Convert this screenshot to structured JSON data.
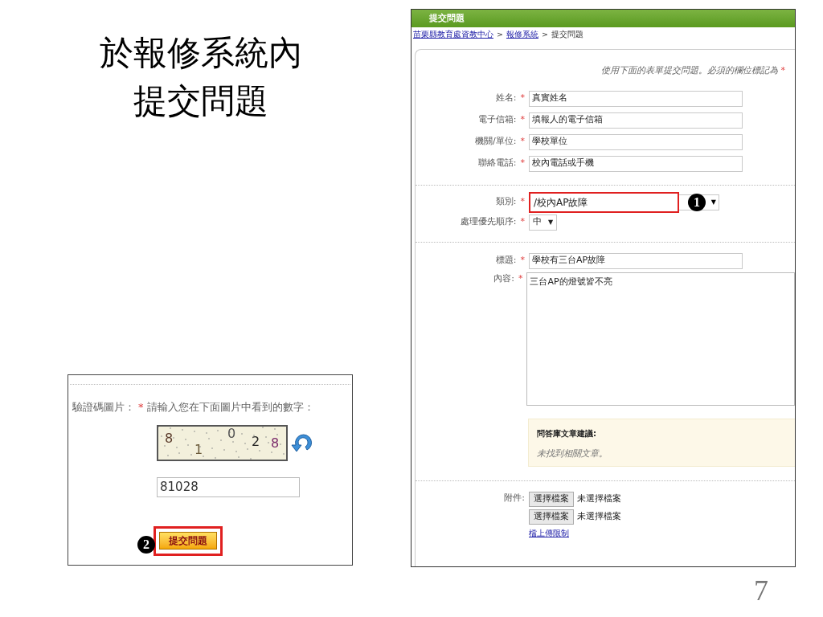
{
  "slide": {
    "title_lines": [
      "於報修系統內",
      "提交問題"
    ],
    "page_number": "7"
  },
  "captcha_panel": {
    "label": "驗證碼圖片：",
    "required_mark": "*",
    "instruction": "請輸入您在下面圖片中看到的數字：",
    "captcha_digits": [
      {
        "text": "8",
        "color": "#5a3a2a"
      },
      {
        "text": "1",
        "color": "#6b5a3a"
      },
      {
        "text": "0",
        "color": "#555555"
      },
      {
        "text": "2",
        "color": "#222222"
      },
      {
        "text": "8",
        "color": "#7a2a6a"
      }
    ],
    "value": "81028",
    "submit_button": "提交問題",
    "callout": "2"
  },
  "form_window": {
    "title": "提交問題",
    "breadcrumb": [
      {
        "text": "苗栗縣教育處資教中心",
        "kind": "link"
      },
      {
        "text": ">",
        "kind": "separator"
      },
      {
        "text": "報修系統",
        "kind": "link"
      },
      {
        "text": ">",
        "kind": "separator"
      },
      {
        "text": "提交問題",
        "kind": "current"
      }
    ],
    "intro": "使用下面的表單提交問題。必須的欄位標記為",
    "intro_mark": "*",
    "contact_fields": [
      {
        "label": "姓名:",
        "required_mark": "*",
        "value": "真實姓名"
      },
      {
        "label": "電子信箱:",
        "required_mark": "*",
        "value": "填報人的電子信箱"
      },
      {
        "label": "機關/單位:",
        "required_mark": "*",
        "value": "學校單位"
      },
      {
        "label": "聯絡電話:",
        "required_mark": "*",
        "value": "校內電話或手機"
      }
    ],
    "category": {
      "label": "類別:",
      "required_mark": "*",
      "value": "/校內AP故障",
      "arrow": "▼",
      "callout": "1"
    },
    "priority": {
      "label": "處理優先順序:",
      "required_mark": "*",
      "value": "中",
      "arrow": "▼"
    },
    "subject": {
      "label": "標題:",
      "required_mark": "*",
      "value": "學校有三台AP故障"
    },
    "content": {
      "label": "內容:",
      "required_mark": "*",
      "value": "三台AP的燈號皆不亮"
    },
    "suggestion": {
      "heading": "問答庫文章建議:",
      "text": "未找到相關文章。"
    },
    "attachments": {
      "label": "附件:",
      "files": [
        {
          "button": "選擇檔案",
          "status": "未選擇檔案"
        },
        {
          "button": "選擇檔案",
          "status": "未選擇檔案"
        }
      ],
      "limit_link": "檔上傳限制"
    }
  }
}
